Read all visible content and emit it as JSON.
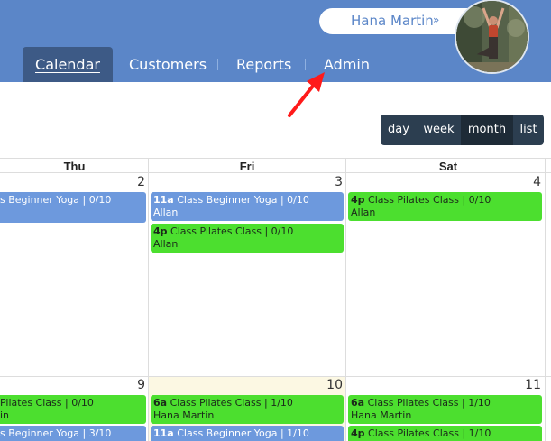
{
  "user": {
    "name": "Hana Martin",
    "chevron_icon": "chevron-double-down-icon"
  },
  "nav": {
    "tabs": [
      {
        "label": "Calendar",
        "active": true
      },
      {
        "label": "Customers",
        "active": false
      },
      {
        "label": "Reports",
        "active": false
      },
      {
        "label": "Admin",
        "active": false
      }
    ]
  },
  "views": [
    {
      "label": "day",
      "active": false
    },
    {
      "label": "week",
      "active": false
    },
    {
      "label": "month",
      "active": true
    },
    {
      "label": "list",
      "active": false
    }
  ],
  "calendar": {
    "days_of_week": [
      "Thu",
      "Fri",
      "Sat"
    ],
    "week1": {
      "dates": [
        "2",
        "3",
        "4"
      ],
      "thu": [
        {
          "time": "",
          "title": "s Beginner Yoga | 0/10",
          "who": "",
          "color": "blue"
        }
      ],
      "fri": [
        {
          "time": "11a",
          "title": "Class Beginner Yoga | 0/10",
          "who": "Allan",
          "color": "blue"
        },
        {
          "time": "4p",
          "title": "Class Pilates Class | 0/10",
          "who": "Allan",
          "color": "green"
        }
      ],
      "sat": [
        {
          "time": "4p",
          "title": "Class Pilates Class | 0/10",
          "who": "Allan",
          "color": "green"
        }
      ]
    },
    "week2": {
      "dates": [
        "9",
        "10",
        "11"
      ],
      "thu": [
        {
          "time": "",
          "title": "Pilates Class | 0/10",
          "who": "in",
          "color": "green"
        },
        {
          "time": "",
          "title": "s Beginner Yoga | 3/10",
          "who": "",
          "color": "blue"
        }
      ],
      "fri": [
        {
          "time": "6a",
          "title": "Class Pilates Class | 1/10",
          "who": "Hana Martin",
          "color": "green"
        },
        {
          "time": "11a",
          "title": "Class Beginner Yoga | 1/10",
          "who": "",
          "color": "blue"
        }
      ],
      "sat": [
        {
          "time": "6a",
          "title": "Class Pilates Class | 1/10",
          "who": "Hana Martin",
          "color": "green"
        },
        {
          "time": "4p",
          "title": "Class Pilates Class | 1/10",
          "who": "",
          "color": "green"
        }
      ]
    }
  },
  "colors": {
    "header": "#5b86c8",
    "event_blue": "#6d99dd",
    "event_green": "#4cdf2f",
    "today": "#fcf8e3",
    "toolbar": "#2c3e50"
  }
}
